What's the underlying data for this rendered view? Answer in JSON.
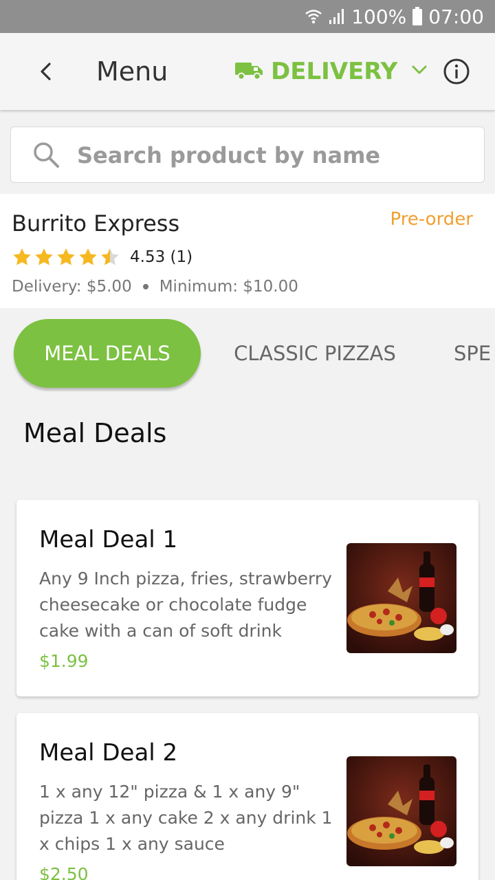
{
  "status_bar": {
    "battery": "100%",
    "time": "07:00"
  },
  "app_bar": {
    "title": "Menu",
    "delivery_label": "DELIVERY"
  },
  "search": {
    "placeholder": "Search product by name",
    "value": ""
  },
  "restaurant": {
    "name": "Burrito Express",
    "order_type": "Pre-order",
    "rating": 4.53,
    "rating_text": "4.53 (1)",
    "delivery_fee": "Delivery: $5.00",
    "minimum": "Minimum: $10.00"
  },
  "tabs": [
    {
      "label": "MEAL DEALS",
      "active": true
    },
    {
      "label": "CLASSIC PIZZAS",
      "active": false
    },
    {
      "label": "SPE",
      "active": false
    }
  ],
  "section": {
    "title": "Meal Deals"
  },
  "products": [
    {
      "name": "Meal Deal 1",
      "description": "Any 9 Inch pizza, fries, strawberry cheesecake or chocolate fudge cake with a can of soft drink",
      "price": "$1.99"
    },
    {
      "name": "Meal Deal 2",
      "description": "1 x any 12\" pizza & 1 x any 9\" pizza  1 x any cake 2 x any drink 1 x chips 1 x any sauce",
      "price": "$2.50"
    }
  ],
  "colors": {
    "accent": "#7cc142",
    "preorder": "#f0a030",
    "star": "#f5b820",
    "status_bar": "#8f8f8f"
  },
  "icons": {
    "back": "back-arrow-icon",
    "delivery": "truck-icon",
    "dropdown": "chevron-down-icon",
    "info": "info-icon",
    "search": "search-icon"
  }
}
